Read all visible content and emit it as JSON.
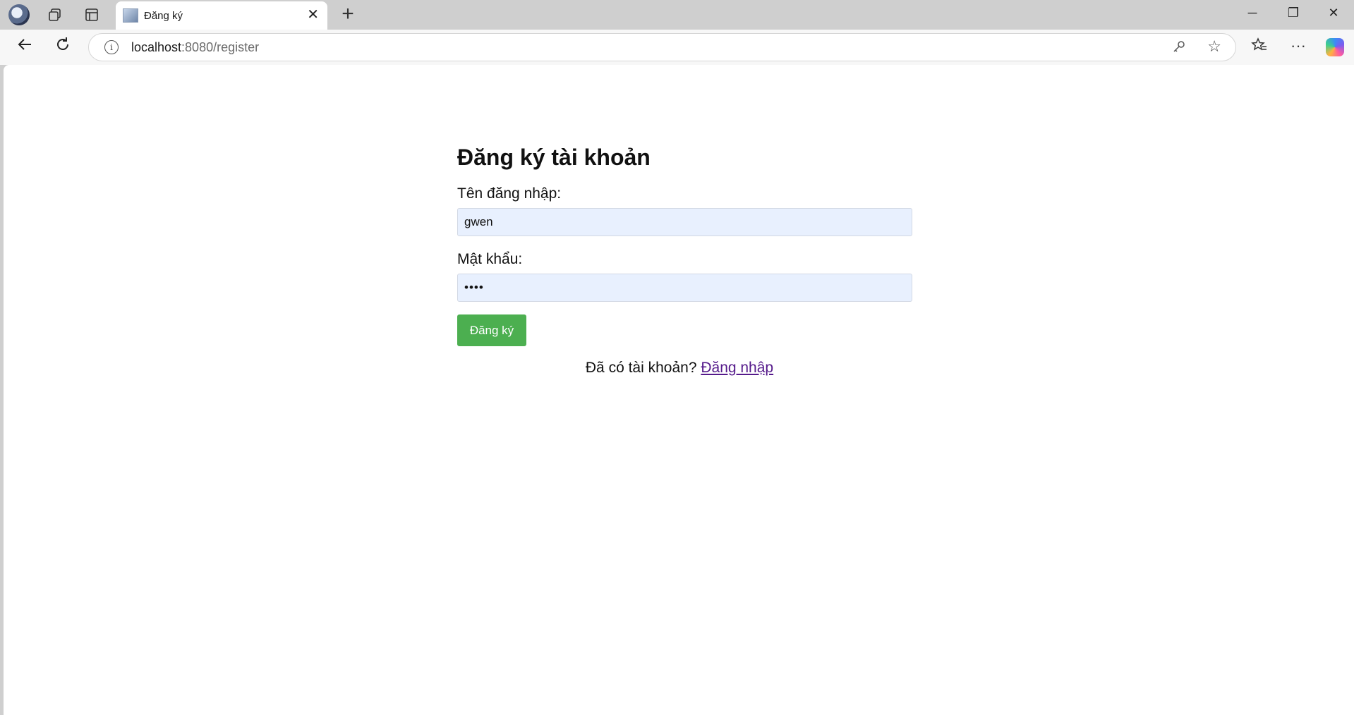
{
  "browser": {
    "tab_title": "Đăng ký",
    "tab_close": "✕",
    "new_tab": "+",
    "url_host": "localhost",
    "url_rest": ":8080/register",
    "window_controls": {
      "minimize": "─",
      "restore": "❐",
      "close": "✕"
    },
    "toolbar_icons": {
      "back": "back-arrow-icon",
      "reload": "reload-icon",
      "favorites": "favorites-icon",
      "more": "more-icon",
      "copilot": "copilot-icon"
    }
  },
  "form": {
    "heading": "Đăng ký tài khoản",
    "username_label": "Tên đăng nhập:",
    "username_value": "gwen",
    "password_label": "Mật khẩu:",
    "password_value": "••••",
    "submit_label": "Đăng ký",
    "login_prompt": "Đã có tài khoản?",
    "login_link": "Đăng nhập"
  },
  "colors": {
    "submit_bg": "#4caf50",
    "field_bg": "#e8f0fe",
    "link_visited": "#551a8b"
  }
}
